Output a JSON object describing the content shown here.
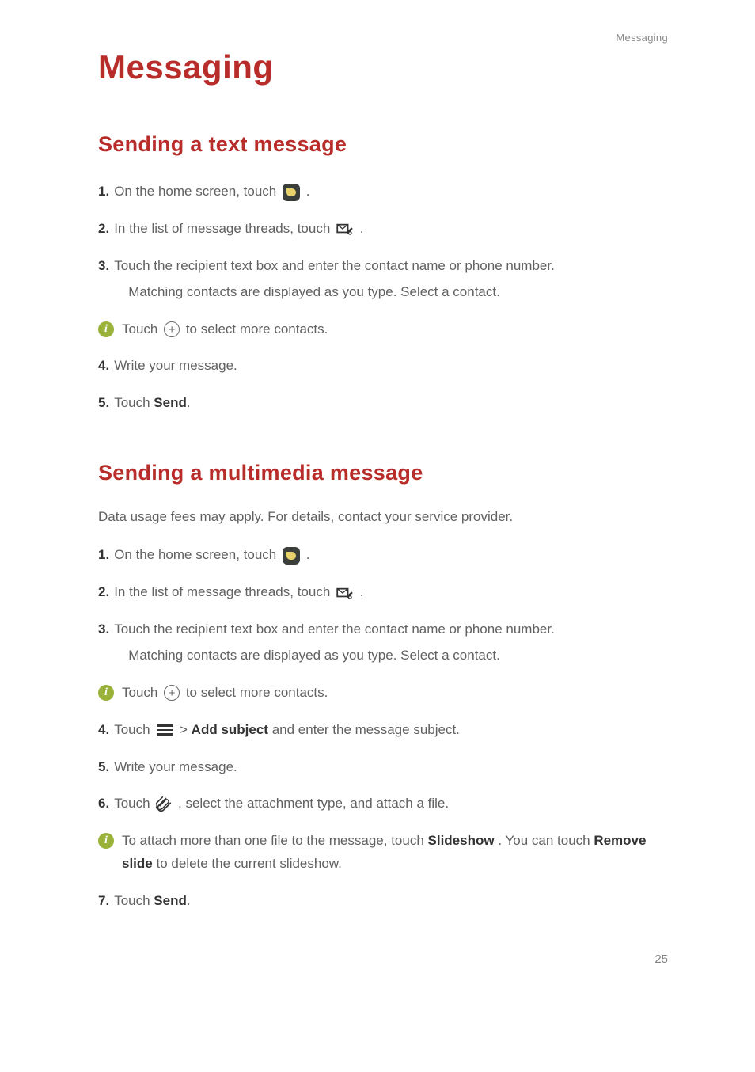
{
  "header": {
    "label": "Messaging"
  },
  "chapter": {
    "title": "Messaging"
  },
  "section1": {
    "title": "Sending a text message",
    "step1": {
      "num": "1.",
      "pre": "On the home screen, touch ",
      "post": "."
    },
    "step2": {
      "num": "2.",
      "pre": "In the list of message threads, touch ",
      "post": "."
    },
    "step3": {
      "num": "3.",
      "line1": "Touch the recipient text box and enter the contact name or phone number.",
      "line2": "Matching contacts are displayed as you type. Select a contact."
    },
    "note1": {
      "pre": "Touch ",
      "post": "to select more contacts."
    },
    "step4": {
      "num": "4.",
      "text": "Write your message."
    },
    "step5": {
      "num": "5.",
      "pre": "Touch ",
      "bold": "Send",
      "post": "."
    }
  },
  "section2": {
    "title": "Sending a multimedia message",
    "intro": "Data usage fees may apply. For details, contact your service provider.",
    "step1": {
      "num": "1.",
      "pre": "On the home screen, touch ",
      "post": "."
    },
    "step2": {
      "num": "2.",
      "pre": "In the list of message threads, touch ",
      "post": "."
    },
    "step3": {
      "num": "3.",
      "line1": "Touch the recipient text box and enter the contact name or phone number.",
      "line2": "Matching contacts are displayed as you type. Select a contact."
    },
    "note1": {
      "pre": "Touch ",
      "post": "to select more contacts."
    },
    "step4": {
      "num": "4.",
      "pre": "Touch ",
      "gt": " > ",
      "bold": "Add subject",
      "post": " and enter the message subject."
    },
    "step5": {
      "num": "5.",
      "text": "Write your message."
    },
    "step6": {
      "num": "6.",
      "pre": "Touch ",
      "post": ", select the attachment type, and attach a file."
    },
    "note2": {
      "pre": "To attach more than one file to the message, touch ",
      "bold1": "Slideshow",
      "mid": ". You can touch ",
      "bold2": "Remove slide",
      "post": " to delete the current slideshow."
    },
    "step7": {
      "num": "7.",
      "pre": "Touch ",
      "bold": "Send",
      "post": "."
    }
  },
  "footer": {
    "pageNum": "25"
  }
}
